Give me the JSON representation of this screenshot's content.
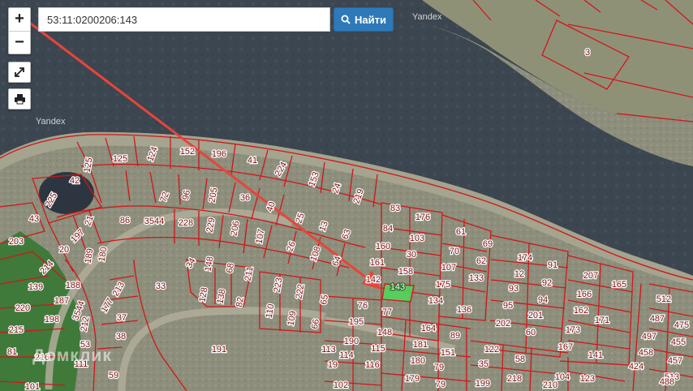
{
  "search": {
    "value": "53:11:0200206:143",
    "button_label": "Найти"
  },
  "controls": {
    "zoom_in": "+",
    "zoom_out": "−"
  },
  "attribution": {
    "yandex_top": "Yandex",
    "yandex_left": "Yandex"
  },
  "watermark": "Домклик",
  "colors": {
    "parcel_line": "#d0161b",
    "highlight": "#53d45a",
    "arrow": "#e8443a",
    "green_zone": "#3f7a3a"
  },
  "parcels": [
    {
      "id": "p125",
      "label": "125"
    },
    {
      "id": "p124",
      "label": "124"
    },
    {
      "id": "p152",
      "label": "152"
    },
    {
      "id": "p196",
      "label": "196"
    },
    {
      "id": "p41",
      "label": "41"
    },
    {
      "id": "p224",
      "label": "224"
    },
    {
      "id": "p153",
      "label": "153"
    },
    {
      "id": "p24",
      "label": "24"
    },
    {
      "id": "p219",
      "label": "219"
    },
    {
      "id": "p125b",
      "label": "125"
    },
    {
      "id": "p42",
      "label": "42"
    },
    {
      "id": "p225",
      "label": "225"
    },
    {
      "id": "p72",
      "label": "72"
    },
    {
      "id": "p96",
      "label": "96"
    },
    {
      "id": "p205",
      "label": "205"
    },
    {
      "id": "p36",
      "label": "36"
    },
    {
      "id": "p40",
      "label": "40"
    },
    {
      "id": "p83",
      "label": "83"
    },
    {
      "id": "p176",
      "label": "176"
    },
    {
      "id": "p43",
      "label": "43"
    },
    {
      "id": "p21",
      "label": "21"
    },
    {
      "id": "p86",
      "label": "86"
    },
    {
      "id": "p3544",
      "label": "3544"
    },
    {
      "id": "p228",
      "label": "228"
    },
    {
      "id": "p229",
      "label": "229"
    },
    {
      "id": "p206",
      "label": "206"
    },
    {
      "id": "p107a",
      "label": "107"
    },
    {
      "id": "p25",
      "label": "25"
    },
    {
      "id": "p13",
      "label": "13"
    },
    {
      "id": "p63",
      "label": "63"
    },
    {
      "id": "p84",
      "label": "84"
    },
    {
      "id": "p103",
      "label": "103"
    },
    {
      "id": "p61",
      "label": "61"
    },
    {
      "id": "p203",
      "label": "203"
    },
    {
      "id": "p197",
      "label": "197"
    },
    {
      "id": "p189",
      "label": "189"
    },
    {
      "id": "p180",
      "label": "180"
    },
    {
      "id": "p20",
      "label": "20"
    },
    {
      "id": "p26",
      "label": "26"
    },
    {
      "id": "p108",
      "label": "108"
    },
    {
      "id": "p64",
      "label": "64"
    },
    {
      "id": "p160",
      "label": "160"
    },
    {
      "id": "p30",
      "label": "30"
    },
    {
      "id": "p70",
      "label": "70"
    },
    {
      "id": "p69",
      "label": "69"
    },
    {
      "id": "p214",
      "label": "214"
    },
    {
      "id": "p34",
      "label": "34"
    },
    {
      "id": "p148",
      "label": "148"
    },
    {
      "id": "p68",
      "label": "68"
    },
    {
      "id": "p211",
      "label": "211"
    },
    {
      "id": "p161",
      "label": "161"
    },
    {
      "id": "p158",
      "label": "158"
    },
    {
      "id": "p107b",
      "label": "107"
    },
    {
      "id": "p62",
      "label": "62"
    },
    {
      "id": "p174",
      "label": "174"
    },
    {
      "id": "p91",
      "label": "91"
    },
    {
      "id": "p139",
      "label": "139"
    },
    {
      "id": "p188",
      "label": "188"
    },
    {
      "id": "p213",
      "label": "213"
    },
    {
      "id": "p33",
      "label": "33"
    },
    {
      "id": "p128",
      "label": "128"
    },
    {
      "id": "p138",
      "label": "138"
    },
    {
      "id": "p82",
      "label": "82"
    },
    {
      "id": "p223",
      "label": "223"
    },
    {
      "id": "p222",
      "label": "222"
    },
    {
      "id": "p65",
      "label": "65"
    },
    {
      "id": "p142",
      "label": "142"
    },
    {
      "id": "p143",
      "label": "143"
    },
    {
      "id": "p175",
      "label": "175"
    },
    {
      "id": "p133",
      "label": "133"
    },
    {
      "id": "p12",
      "label": "12"
    },
    {
      "id": "p92",
      "label": "92"
    },
    {
      "id": "p207",
      "label": "207"
    },
    {
      "id": "p165",
      "label": "165"
    },
    {
      "id": "p220",
      "label": "220"
    },
    {
      "id": "p187",
      "label": "187"
    },
    {
      "id": "p3544b",
      "label": "3544"
    },
    {
      "id": "p177",
      "label": "177"
    },
    {
      "id": "p37",
      "label": "37"
    },
    {
      "id": "p110",
      "label": "110"
    },
    {
      "id": "p109",
      "label": "109"
    },
    {
      "id": "p66",
      "label": "66"
    },
    {
      "id": "p76",
      "label": "76"
    },
    {
      "id": "p134",
      "label": "134"
    },
    {
      "id": "p136",
      "label": "136"
    },
    {
      "id": "p93",
      "label": "93"
    },
    {
      "id": "p94",
      "label": "94"
    },
    {
      "id": "p166",
      "label": "166"
    },
    {
      "id": "p512",
      "label": "512"
    },
    {
      "id": "p215",
      "label": "215"
    },
    {
      "id": "p198",
      "label": "198"
    },
    {
      "id": "p212",
      "label": "212"
    },
    {
      "id": "p38",
      "label": "38"
    },
    {
      "id": "p195",
      "label": "195"
    },
    {
      "id": "p77",
      "label": "77"
    },
    {
      "id": "p148b",
      "label": "148"
    },
    {
      "id": "p95",
      "label": "95"
    },
    {
      "id": "p201",
      "label": "201"
    },
    {
      "id": "p162",
      "label": "162"
    },
    {
      "id": "p487",
      "label": "487"
    },
    {
      "id": "p475",
      "label": "475"
    },
    {
      "id": "p53",
      "label": "53"
    },
    {
      "id": "p190",
      "label": "190"
    },
    {
      "id": "p115",
      "label": "115"
    },
    {
      "id": "p164",
      "label": "164"
    },
    {
      "id": "p89",
      "label": "89"
    },
    {
      "id": "p202",
      "label": "202"
    },
    {
      "id": "p60",
      "label": "60"
    },
    {
      "id": "p173",
      "label": "173"
    },
    {
      "id": "p171",
      "label": "171"
    },
    {
      "id": "p497",
      "label": "497"
    },
    {
      "id": "p455",
      "label": "455"
    },
    {
      "id": "p81",
      "label": "81"
    },
    {
      "id": "p216",
      "label": "216"
    },
    {
      "id": "p113",
      "label": "113"
    },
    {
      "id": "p191",
      "label": "191"
    },
    {
      "id": "p114",
      "label": "114"
    },
    {
      "id": "p181",
      "label": "181"
    },
    {
      "id": "p151",
      "label": "151"
    },
    {
      "id": "p122",
      "label": "122"
    },
    {
      "id": "p58",
      "label": "58"
    },
    {
      "id": "p167",
      "label": "167"
    },
    {
      "id": "p141",
      "label": "141"
    },
    {
      "id": "p458",
      "label": "458"
    },
    {
      "id": "p457",
      "label": "457"
    },
    {
      "id": "p111",
      "label": "111"
    },
    {
      "id": "p59",
      "label": "59"
    },
    {
      "id": "p19",
      "label": "19"
    },
    {
      "id": "p116",
      "label": "116"
    },
    {
      "id": "p180b",
      "label": "180"
    },
    {
      "id": "p79a",
      "label": "79"
    },
    {
      "id": "p35",
      "label": "35"
    },
    {
      "id": "p218",
      "label": "218"
    },
    {
      "id": "p104",
      "label": "104"
    },
    {
      "id": "p123",
      "label": "123"
    },
    {
      "id": "p424",
      "label": "424"
    },
    {
      "id": "p513",
      "label": "513"
    },
    {
      "id": "p3",
      "label": "3"
    },
    {
      "id": "p179",
      "label": "179"
    },
    {
      "id": "p79b",
      "label": "79"
    },
    {
      "id": "p199",
      "label": "199"
    },
    {
      "id": "p210",
      "label": "210"
    },
    {
      "id": "p488",
      "label": "488"
    },
    {
      "id": "p101",
      "label": "101"
    },
    {
      "id": "p102",
      "label": "102"
    }
  ]
}
